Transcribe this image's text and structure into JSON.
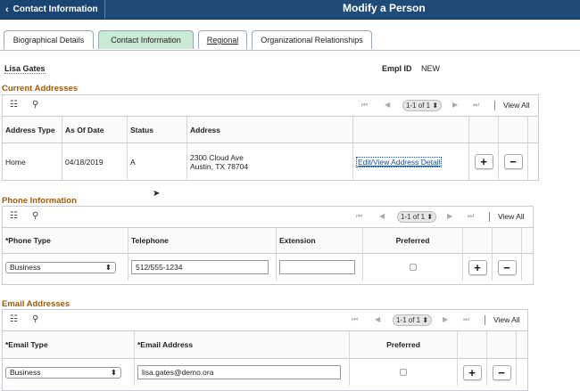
{
  "header": {
    "back_label": "Contact Information",
    "title": "Modify a Person"
  },
  "tabs": [
    {
      "label": "Biographical Details"
    },
    {
      "label": "Contact Information"
    },
    {
      "label": "Regional"
    },
    {
      "label": "Organizational Relationships"
    }
  ],
  "person": {
    "name": "Lisa Gates",
    "emplid_label": "Empl ID",
    "emplid_value": "NEW"
  },
  "grids": {
    "pager_text": "1-1 of 1",
    "view_all": "View All"
  },
  "addresses": {
    "title": "Current Addresses",
    "headers": [
      "Address Type",
      "As Of Date",
      "Status",
      "Address"
    ],
    "row": {
      "type": "Home",
      "as_of_date": "04/18/2019",
      "status": "A",
      "address_line1": "2300 Cloud Ave",
      "address_line2": "Austin, TX 78704",
      "edit_link": "Edit/View Address Detail"
    }
  },
  "phone": {
    "title": "Phone Information",
    "headers": [
      "*Phone Type",
      "Telephone",
      "Extension",
      "Preferred"
    ],
    "row": {
      "type": "Business",
      "telephone": "512/555-1234",
      "extension": "",
      "preferred": false
    }
  },
  "email": {
    "title": "Email Addresses",
    "headers": [
      "*Email Type",
      "*Email Address",
      "Preferred"
    ],
    "row": {
      "type": "Business",
      "address": "lisa.gates@demo.ora",
      "preferred": false
    }
  },
  "buttons": {
    "add": "+",
    "remove": "−"
  },
  "colors": {
    "banner": "#1e4b78",
    "active_tab": "#c9ead3",
    "section_title": "#a35a00",
    "link": "#1a4fa0"
  }
}
